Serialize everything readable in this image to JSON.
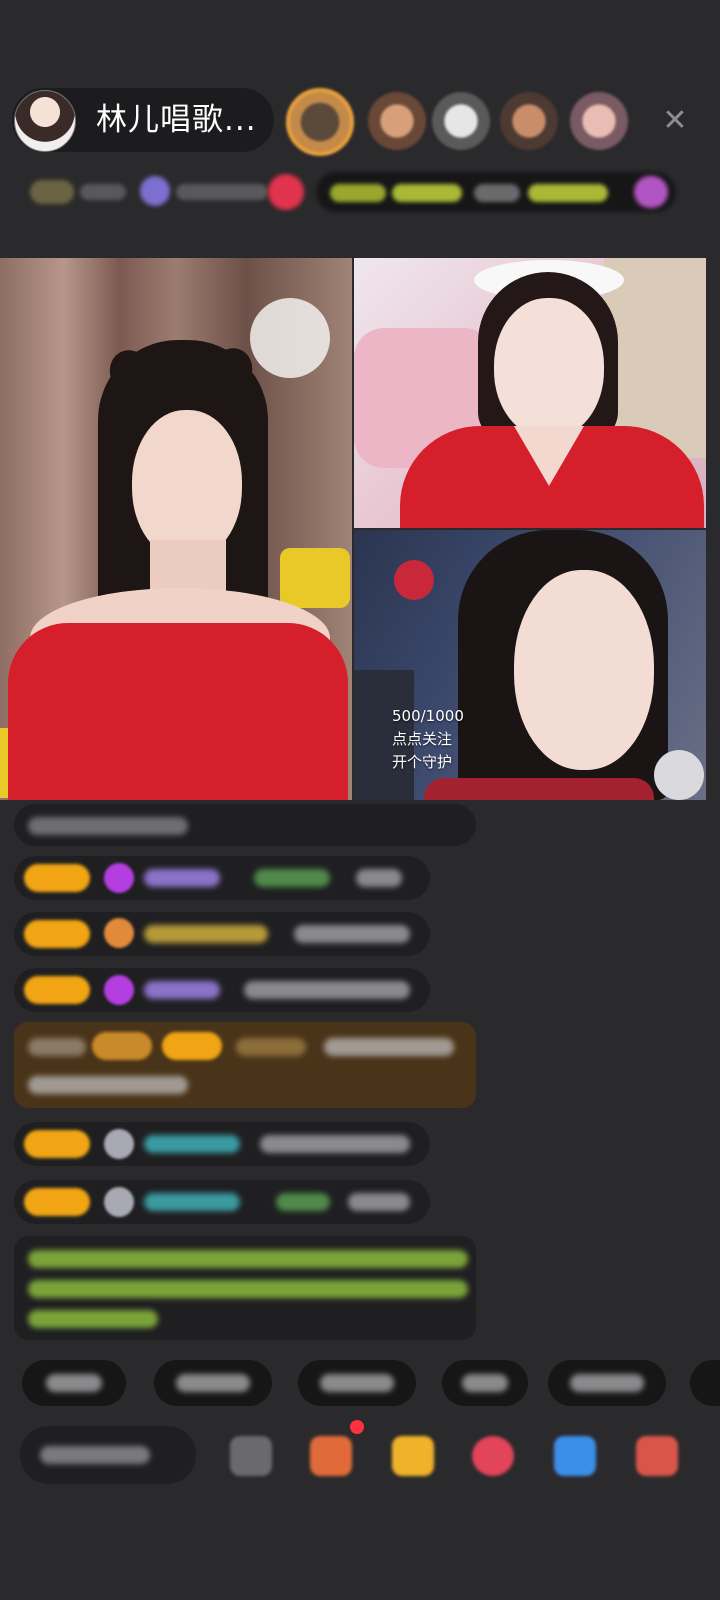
{
  "header": {
    "host_name": "林儿唱歌...",
    "close_icon": "close-icon"
  },
  "video": {
    "overlay_progress": "500/1000",
    "overlay_follow": "点点关注",
    "overlay_guard": "开个守护"
  },
  "colors": {
    "background": "#2a2a2c",
    "badge": "#f1a514",
    "highlight_message": "#4a3419",
    "system_message_text": "#8bc34a",
    "accent_red": "#d51f2b"
  }
}
